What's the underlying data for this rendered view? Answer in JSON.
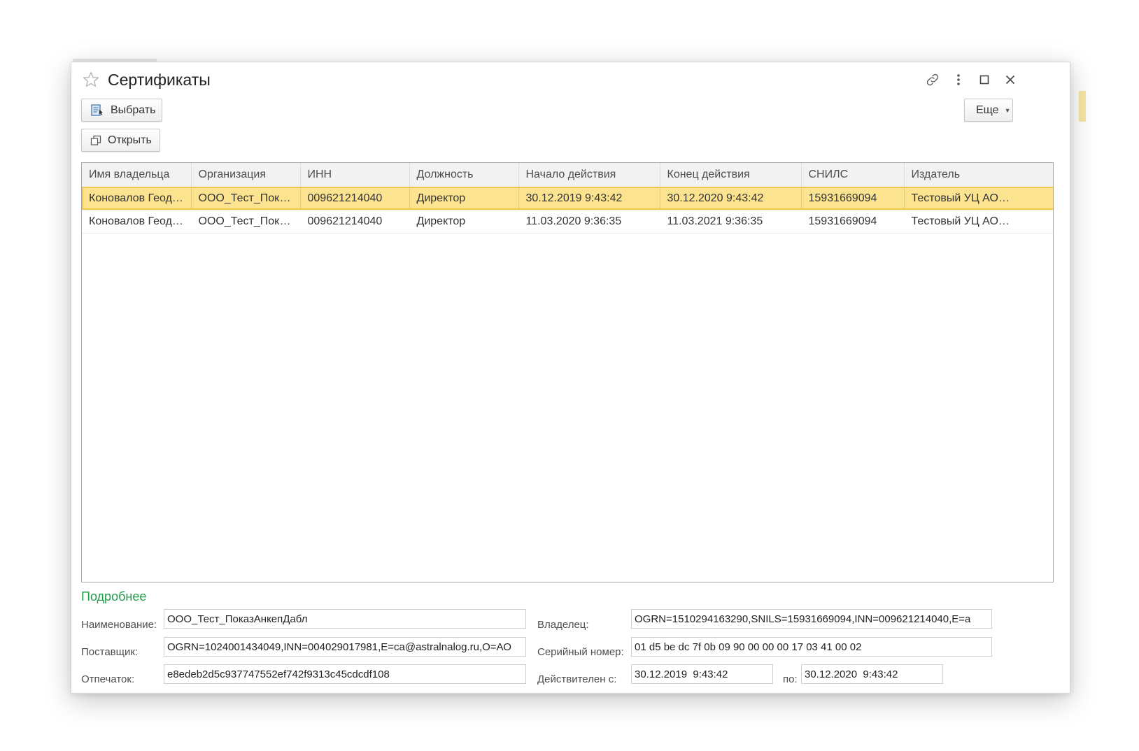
{
  "window": {
    "title": "Сертификаты"
  },
  "toolbar": {
    "select_label": "Выбрать",
    "open_label": "Открыть",
    "more_label": "Еще"
  },
  "table": {
    "columns": [
      "Имя владельца",
      "Организация",
      "ИНН",
      "Должность",
      "Начало действия",
      "Конец действия",
      "СНИЛС",
      "Издатель"
    ],
    "rows": [
      [
        "Коновалов Геод…",
        "ООО_Тест_Пока…",
        "009621214040",
        "Директор",
        "30.12.2019 9:43:42",
        "30.12.2020 9:43:42",
        "15931669094",
        "Тестовый УЦ АО…"
      ],
      [
        "Коновалов Геод…",
        "ООО_Тест_Пока…",
        "009621214040",
        "Директор",
        "11.03.2020 9:36:35",
        "11.03.2021 9:36:35",
        "15931669094",
        "Тестовый УЦ АО…"
      ]
    ],
    "selected_row": 0
  },
  "details": {
    "title": "Подробнее",
    "name_label": "Наименование:",
    "name_value": "ООО_Тест_ПоказАнкепДабл",
    "supplier_label": "Поставщик:",
    "supplier_value": "OGRN=1024001434049,INN=004029017981,E=ca@astralnalog.ru,O=АО",
    "thumbprint_label": "Отпечаток:",
    "thumbprint_value": "e8edeb2d5c937747552ef742f9313c45cdcdf108",
    "owner_label": "Владелец:",
    "owner_value": "OGRN=1510294163290,SNILS=15931669094,INN=009621214040,E=a",
    "serial_label": "Серийный номер:",
    "serial_value": "01 d5 be dc 7f 0b 09 90 00 00 00 17 03 41 00 02",
    "valid_from_label": "Действителен с:",
    "valid_from_value": "30.12.2019  9:43:42",
    "valid_to_label": "по:",
    "valid_to_value": "30.12.2020  9:43:42"
  },
  "colors": {
    "accent_green": "#1f9e4a",
    "selection": "#fbe38f",
    "selection_border": "#f2c84b"
  }
}
